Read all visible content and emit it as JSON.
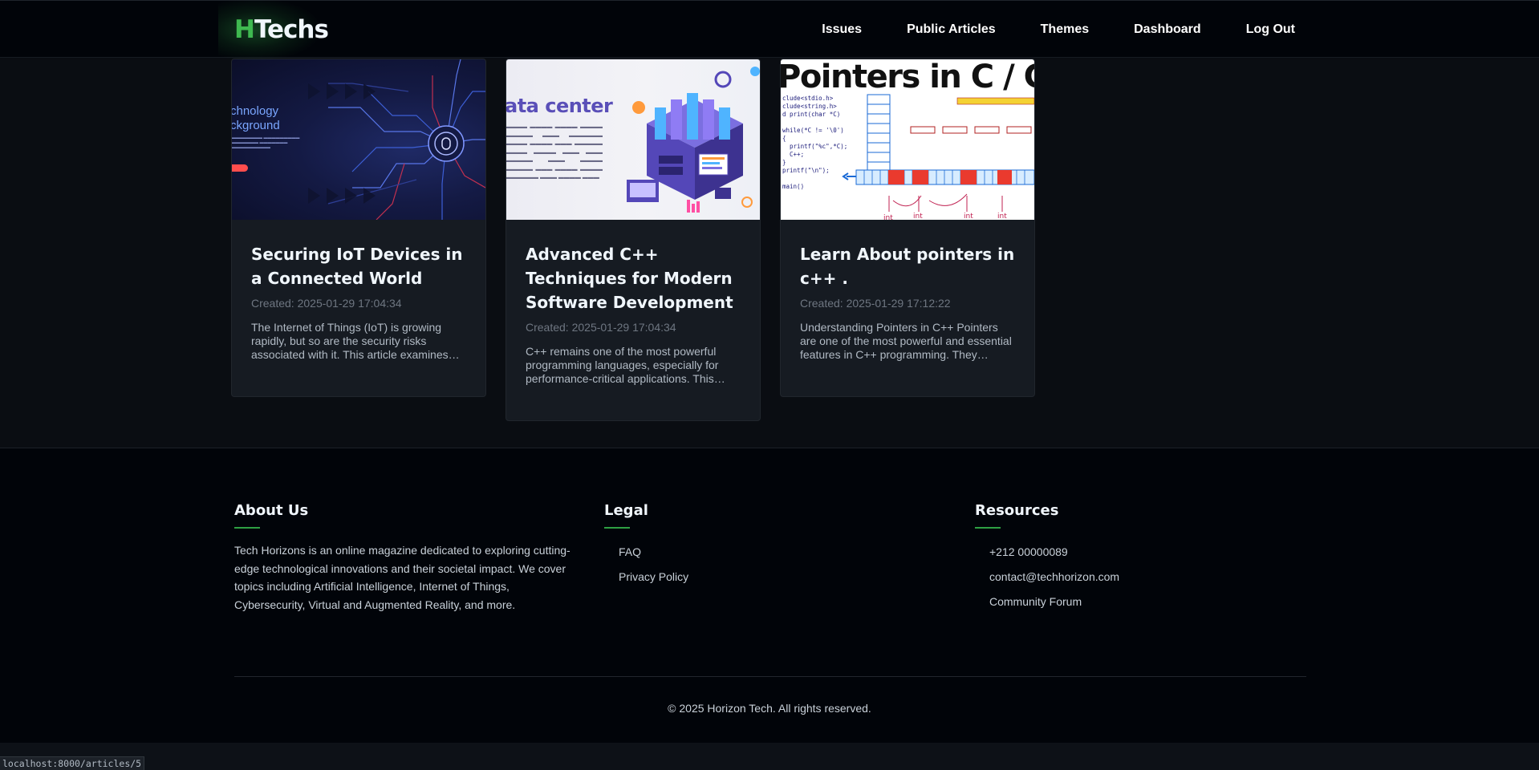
{
  "navbar": {
    "logo_mark": "H",
    "logo_text": "Techs",
    "links": [
      "Issues",
      "Public Articles",
      "Themes",
      "Dashboard",
      "Log Out"
    ]
  },
  "articles": [
    {
      "title": "Securing IoT Devices in a Connected World",
      "created": "Created: 2025-01-29 17:04:34",
      "excerpt": "The Internet of Things (IoT) is growing rapidly, but so are the security risks associated with it. This article examines…",
      "image_text": [
        "chnology",
        "ckground"
      ]
    },
    {
      "title": "Advanced C++ Techniques for Modern Software Development",
      "created": "Created: 2025-01-29 17:04:34",
      "excerpt": "C++ remains one of the most powerful programming languages, especially for performance-critical applications. This…",
      "image_text": [
        "ata center"
      ]
    },
    {
      "title": "Learn About pointers in c++ .",
      "created": "Created: 2025-01-29 17:12:22",
      "excerpt": "Understanding Pointers in C++ Pointers are one of the most powerful and essential features in C++ programming. They allow…",
      "image_text": [
        "Pointers in C / C++"
      ]
    }
  ],
  "footer": {
    "about": {
      "heading": "About Us",
      "text": "Tech Horizons is an online magazine dedicated to exploring cutting-edge technological innovations and their societal impact. We cover topics including Artificial Intelligence, Internet of Things, Cybersecurity, Virtual and Augmented Reality, and more."
    },
    "legal": {
      "heading": "Legal",
      "links": [
        "FAQ",
        "Privacy Policy"
      ]
    },
    "resources": {
      "heading": "Resources",
      "links": [
        "+212 00000089",
        "contact@techhorizon.com",
        "Community Forum"
      ]
    },
    "copyright": "© 2025 Horizon Tech. All rights reserved."
  },
  "status_bar": {
    "url": "localhost:8000/articles/5"
  },
  "colors": {
    "accent": "#2ea043",
    "background": "#0a0d12",
    "card": "#161b22",
    "navbar": "#010409"
  }
}
